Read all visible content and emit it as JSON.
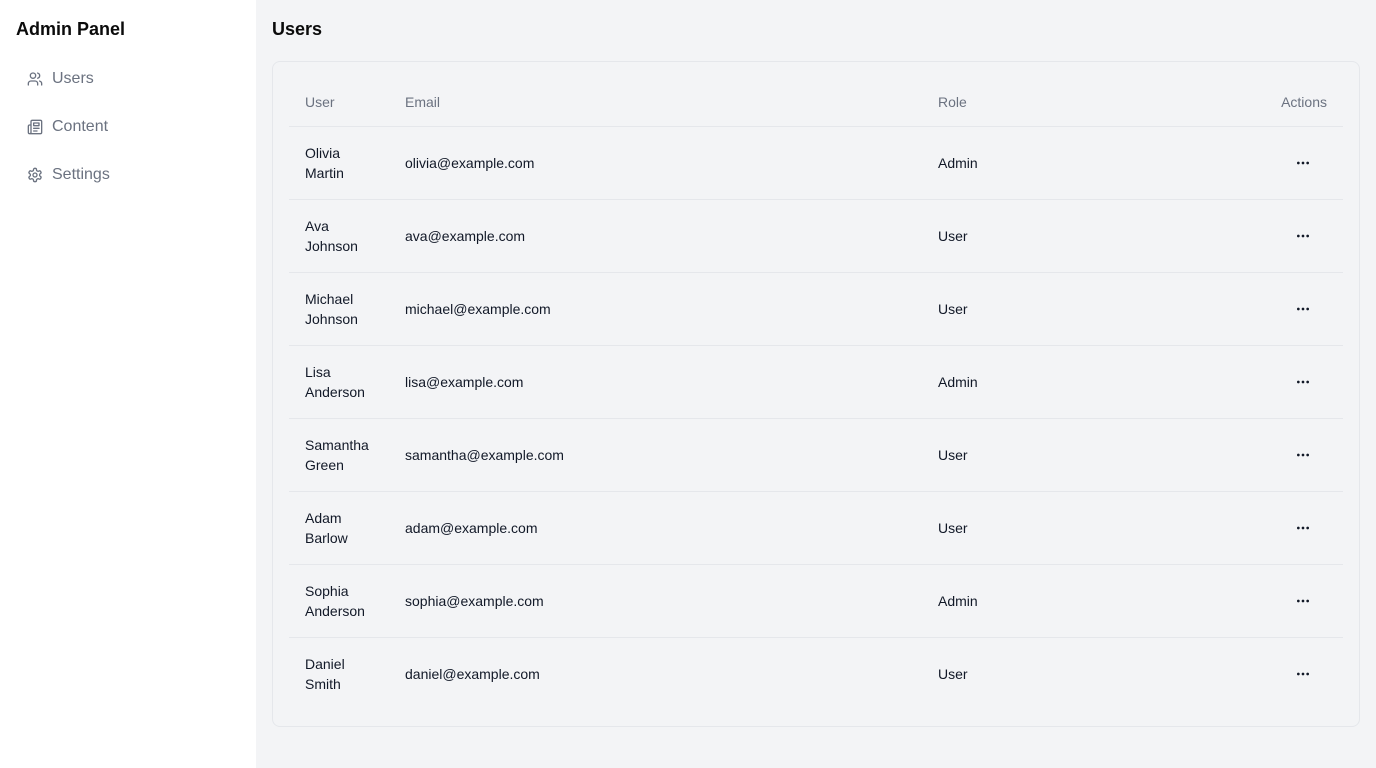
{
  "sidebar": {
    "brand": "Admin Panel",
    "items": [
      {
        "label": "Users",
        "icon": "users-icon"
      },
      {
        "label": "Content",
        "icon": "newspaper-icon"
      },
      {
        "label": "Settings",
        "icon": "gear-icon"
      }
    ]
  },
  "main": {
    "title": "Users",
    "table": {
      "headers": {
        "user": "User",
        "email": "Email",
        "role": "Role",
        "actions": "Actions"
      },
      "rows": [
        {
          "first": "Olivia",
          "last": "Martin",
          "email": "olivia@example.com",
          "role": "Admin"
        },
        {
          "first": "Ava",
          "last": "Johnson",
          "email": "ava@example.com",
          "role": "User"
        },
        {
          "first": "Michael",
          "last": "Johnson",
          "email": "michael@example.com",
          "role": "User"
        },
        {
          "first": "Lisa",
          "last": "Anderson",
          "email": "lisa@example.com",
          "role": "Admin"
        },
        {
          "first": "Samantha",
          "last": "Green",
          "email": "samantha@example.com",
          "role": "User"
        },
        {
          "first": "Adam",
          "last": "Barlow",
          "email": "adam@example.com",
          "role": "User"
        },
        {
          "first": "Sophia",
          "last": "Anderson",
          "email": "sophia@example.com",
          "role": "Admin"
        },
        {
          "first": "Daniel",
          "last": "Smith",
          "email": "daniel@example.com",
          "role": "User"
        }
      ]
    }
  }
}
